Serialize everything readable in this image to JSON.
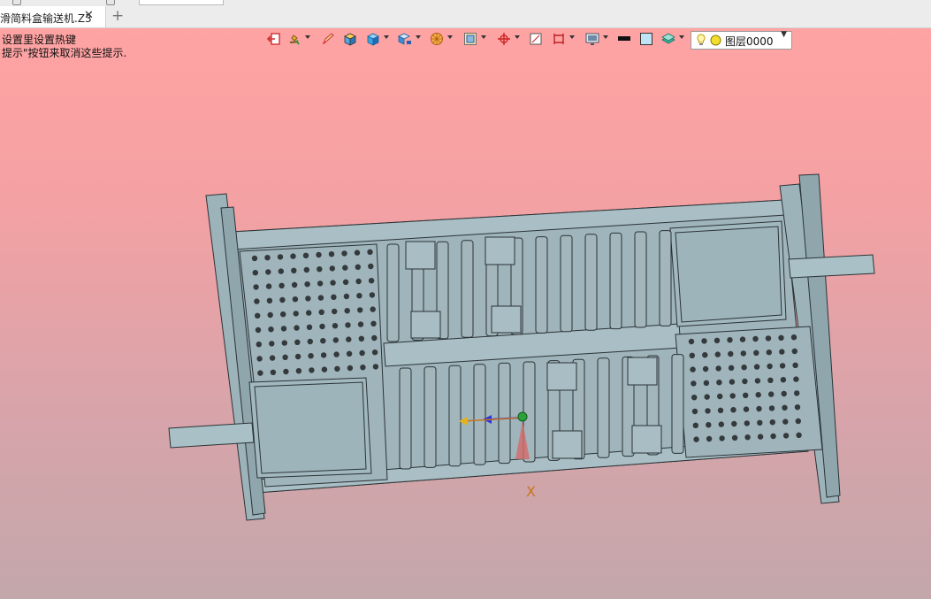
{
  "tab": {
    "title": "滑简料盒输送机.Z3",
    "close_glyph": "✕",
    "add_glyph": "+"
  },
  "viewport": {
    "hint_line1": "设置里设置热键",
    "hint_line2": "提示\"按钮来取消这些提示."
  },
  "toolbar": {
    "items": [
      {
        "icon": "exit-sketch-icon"
      },
      {
        "icon": "paint-brush-icon"
      },
      {
        "icon": "pencil-edit-icon"
      },
      {
        "icon": "shaded-cube-icon"
      },
      {
        "icon": "blue-cube-icon"
      },
      {
        "icon": "view-direction-icon"
      },
      {
        "icon": "render-mode-icon"
      },
      {
        "icon": "frame-zoom-icon"
      },
      {
        "icon": "origin-axis-icon"
      },
      {
        "icon": "section-plane-icon"
      },
      {
        "icon": "dimension-icon"
      },
      {
        "icon": "display-filter-icon"
      },
      {
        "icon": "line-color-icon"
      },
      {
        "icon": "face-color-icon"
      },
      {
        "icon": "layer-stack-icon"
      }
    ],
    "layer": {
      "label": "图层0000",
      "bulb_icon": "lightbulb-icon",
      "status_icon": "yellow-circle-icon"
    }
  },
  "model": {
    "triad_axis_label": "X",
    "colors": {
      "frame": "#9fb4bb",
      "outline": "#2b3336",
      "roller": "#a3b6bc",
      "ball": "#34393b",
      "axis_x": "#c8751c",
      "axis_y": "#2d34d8"
    }
  }
}
